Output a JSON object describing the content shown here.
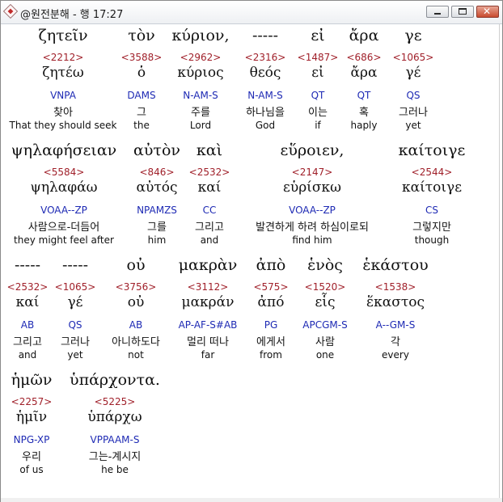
{
  "window": {
    "title": "@원전분해 - 행 17:27",
    "close_glyph": "✕"
  },
  "rows": [
    [
      {
        "greek": "ζητεῖν",
        "strong": "<2212>",
        "lemma": "ζητέω",
        "parse": "VNPA",
        "korean": "찾아",
        "english": "That they should seek"
      },
      {
        "greek": "τὸν",
        "strong": "<3588>",
        "lemma": "ὁ",
        "parse": "DAMS",
        "korean": "그",
        "english": "the"
      },
      {
        "greek": "κύριον,",
        "strong": "<2962>",
        "lemma": "κύριος",
        "parse": "N-AM-S",
        "korean": "주를",
        "english": "Lord"
      },
      {
        "greek": "-----",
        "strong": "<2316>",
        "lemma": "θεός",
        "parse": "N-AM-S",
        "korean": "하나님을",
        "english": "God"
      },
      {
        "greek": "εἰ",
        "strong": "<1487>",
        "lemma": "εἰ",
        "parse": "QT",
        "korean": "이는",
        "english": "if"
      },
      {
        "greek": "ἄρα",
        "strong": "<686>",
        "lemma": "ἄρα",
        "parse": "QT",
        "korean": "혹",
        "english": "haply"
      },
      {
        "greek": "γε",
        "strong": "<1065>",
        "lemma": "γέ",
        "parse": "QS",
        "korean": "그러나",
        "english": "yet"
      }
    ],
    [
      {
        "greek": "ψηλαφήσειαν",
        "strong": "<5584>",
        "lemma": "ψηλαφάω",
        "parse": "VOAA--ZP",
        "korean": "사람으로-더듬어",
        "english": "they might feel after"
      },
      {
        "greek": "αὐτὸν",
        "strong": "<846>",
        "lemma": "αὐτός",
        "parse": "NPAMZS",
        "korean": "그를",
        "english": "him"
      },
      {
        "greek": "καὶ",
        "strong": "<2532>",
        "lemma": "καί",
        "parse": "CC",
        "korean": "그리고",
        "english": "and"
      },
      {
        "greek": "εὕροιεν,",
        "strong": "<2147>",
        "lemma": "εὑρίσκω",
        "parse": "VOAA--ZP",
        "korean": "발견하게 하려 하심이로되",
        "english": "find him"
      },
      {
        "greek": "καίτοιγε",
        "strong": "<2544>",
        "lemma": "καίτοιγε",
        "parse": "CS",
        "korean": "그렇지만",
        "english": "though"
      }
    ],
    [
      {
        "greek": "-----",
        "strong": "<2532>",
        "lemma": "καί",
        "parse": "AB",
        "korean": "그리고",
        "english": "and"
      },
      {
        "greek": "-----",
        "strong": "<1065>",
        "lemma": "γέ",
        "parse": "QS",
        "korean": "그러나",
        "english": "yet"
      },
      {
        "greek": "οὐ",
        "strong": "<3756>",
        "lemma": "οὐ",
        "parse": "AB",
        "korean": "아니하도다",
        "english": "not"
      },
      {
        "greek": "μακρὰν",
        "strong": "<3112>",
        "lemma": "μακράν",
        "parse": "AP-AF-S#AB",
        "korean": "멀리 떠나",
        "english": "far"
      },
      {
        "greek": "ἀπὸ",
        "strong": "<575>",
        "lemma": "ἀπό",
        "parse": "PG",
        "korean": "에게서",
        "english": "from"
      },
      {
        "greek": "ἑνὸς",
        "strong": "<1520>",
        "lemma": "εἷς",
        "parse": "APCGM-S",
        "korean": "사람",
        "english": "one"
      },
      {
        "greek": "ἑκάστου",
        "strong": "<1538>",
        "lemma": "ἕκαστος",
        "parse": "A--GM-S",
        "korean": "각",
        "english": "every"
      }
    ],
    [
      {
        "greek": "ἡμῶν",
        "strong": "<2257>",
        "lemma": "ἡμῖν",
        "parse": "NPG-XP",
        "korean": "우리",
        "english": "of us"
      },
      {
        "greek": "ὑπάρχοντα.",
        "strong": "<5225>",
        "lemma": "ὑπάρχω",
        "parse": "VPPAAM-S",
        "korean": "그는-계시지",
        "english": "he be"
      }
    ]
  ]
}
